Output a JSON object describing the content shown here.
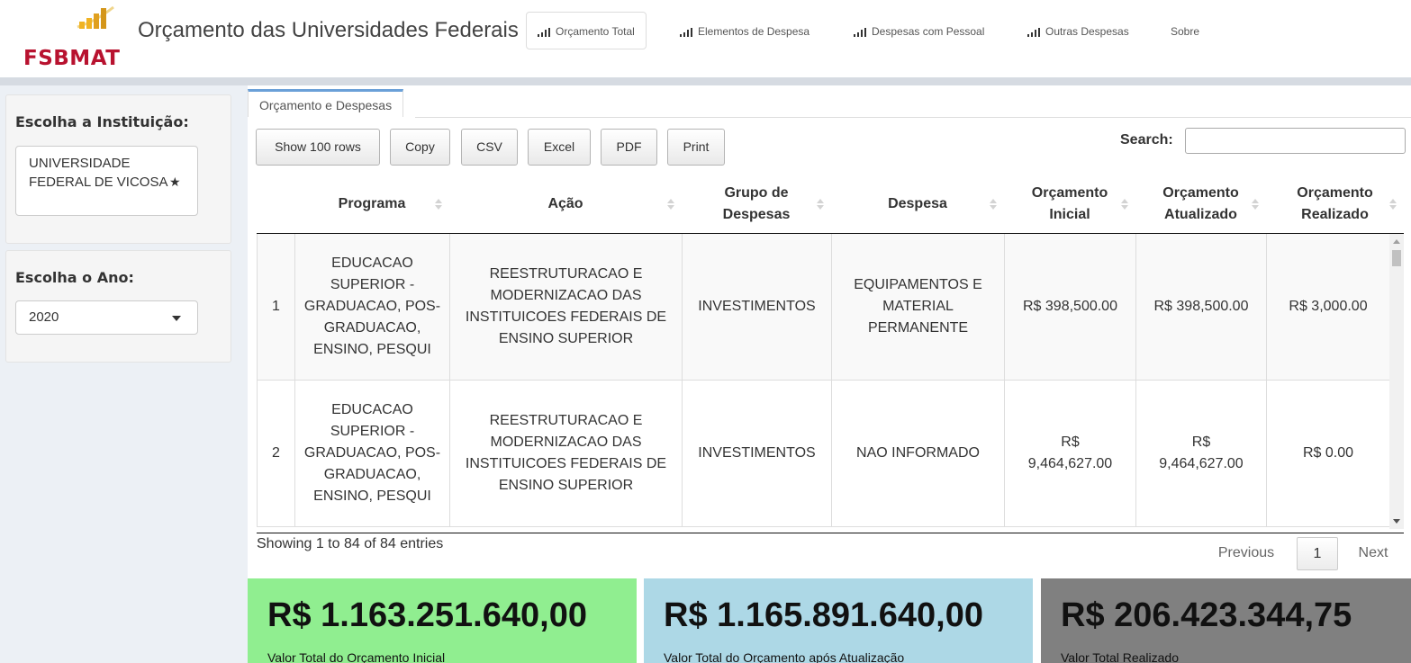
{
  "app": {
    "logo_text": "FSBMAT",
    "title": "Orçamento das Universidades Federais"
  },
  "nav": {
    "tabs": [
      {
        "label": "Orçamento Total",
        "icon": "bar-chart-icon"
      },
      {
        "label": "Elementos de Despesa",
        "icon": "bar-chart-icon"
      },
      {
        "label": "Despesas com Pessoal",
        "icon": "bar-chart-icon"
      },
      {
        "label": "Outras Despesas",
        "icon": "bar-chart-icon"
      },
      {
        "label": "Sobre",
        "icon": ""
      }
    ],
    "active_index": 0
  },
  "sidebar": {
    "institution_label": "Escolha a Instituição:",
    "institution_value": "UNIVERSIDADE FEDERAL DE VICOSA",
    "year_label": "Escolha o Ano:",
    "year_value": "2020"
  },
  "content_tab": "Orçamento e Despesas",
  "toolbar": {
    "buttons": [
      "Show 100 rows",
      "Copy",
      "CSV",
      "Excel",
      "PDF",
      "Print"
    ],
    "search_label": "Search:",
    "search_value": ""
  },
  "table": {
    "headers": [
      "",
      "Programa",
      "Ação",
      "Grupo de Despesas",
      "Despesa",
      "Orçamento Inicial",
      "Orçamento Atualizado",
      "Orçamento Realizado"
    ],
    "rows": [
      [
        "1",
        "EDUCACAO SUPERIOR - GRADUACAO, POS-GRADUACAO, ENSINO, PESQUI",
        "REESTRUTURACAO E MODERNIZACAO DAS INSTITUICOES FEDERAIS DE ENSINO SUPERIOR",
        "INVESTIMENTOS",
        "EQUIPAMENTOS E MATERIAL PERMANENTE",
        "R$ 398,500.00",
        "R$ 398,500.00",
        "R$ 3,000.00"
      ],
      [
        "2",
        "EDUCACAO SUPERIOR - GRADUACAO, POS-GRADUACAO, ENSINO, PESQUI",
        "REESTRUTURACAO E MODERNIZACAO DAS INSTITUICOES FEDERAIS DE ENSINO SUPERIOR",
        "INVESTIMENTOS",
        "NAO INFORMADO",
        "R$ 9,464,627.00",
        "R$ 9,464,627.00",
        "R$ 0.00"
      ]
    ],
    "info": "Showing 1 to 84 of 84 entries",
    "pagination": {
      "previous": "Previous",
      "current": "1",
      "next": "Next"
    }
  },
  "value_boxes": [
    {
      "amount": "R$ 1.163.251.640,00",
      "caption": "Valor Total do Orçamento Inicial",
      "color": "#90ee90"
    },
    {
      "amount": "R$ 1.165.891.640,00",
      "caption": "Valor Total do Orçamento após Atualização",
      "color": "#add8e6"
    },
    {
      "amount": "R$ 206.423.344,75",
      "caption": "Valor Total Realizado",
      "color": "#808080"
    }
  ],
  "colors": {
    "logo_red": "#b8122f",
    "logo_gold": "#f0b323",
    "tab_accent": "#6aa0d8"
  }
}
